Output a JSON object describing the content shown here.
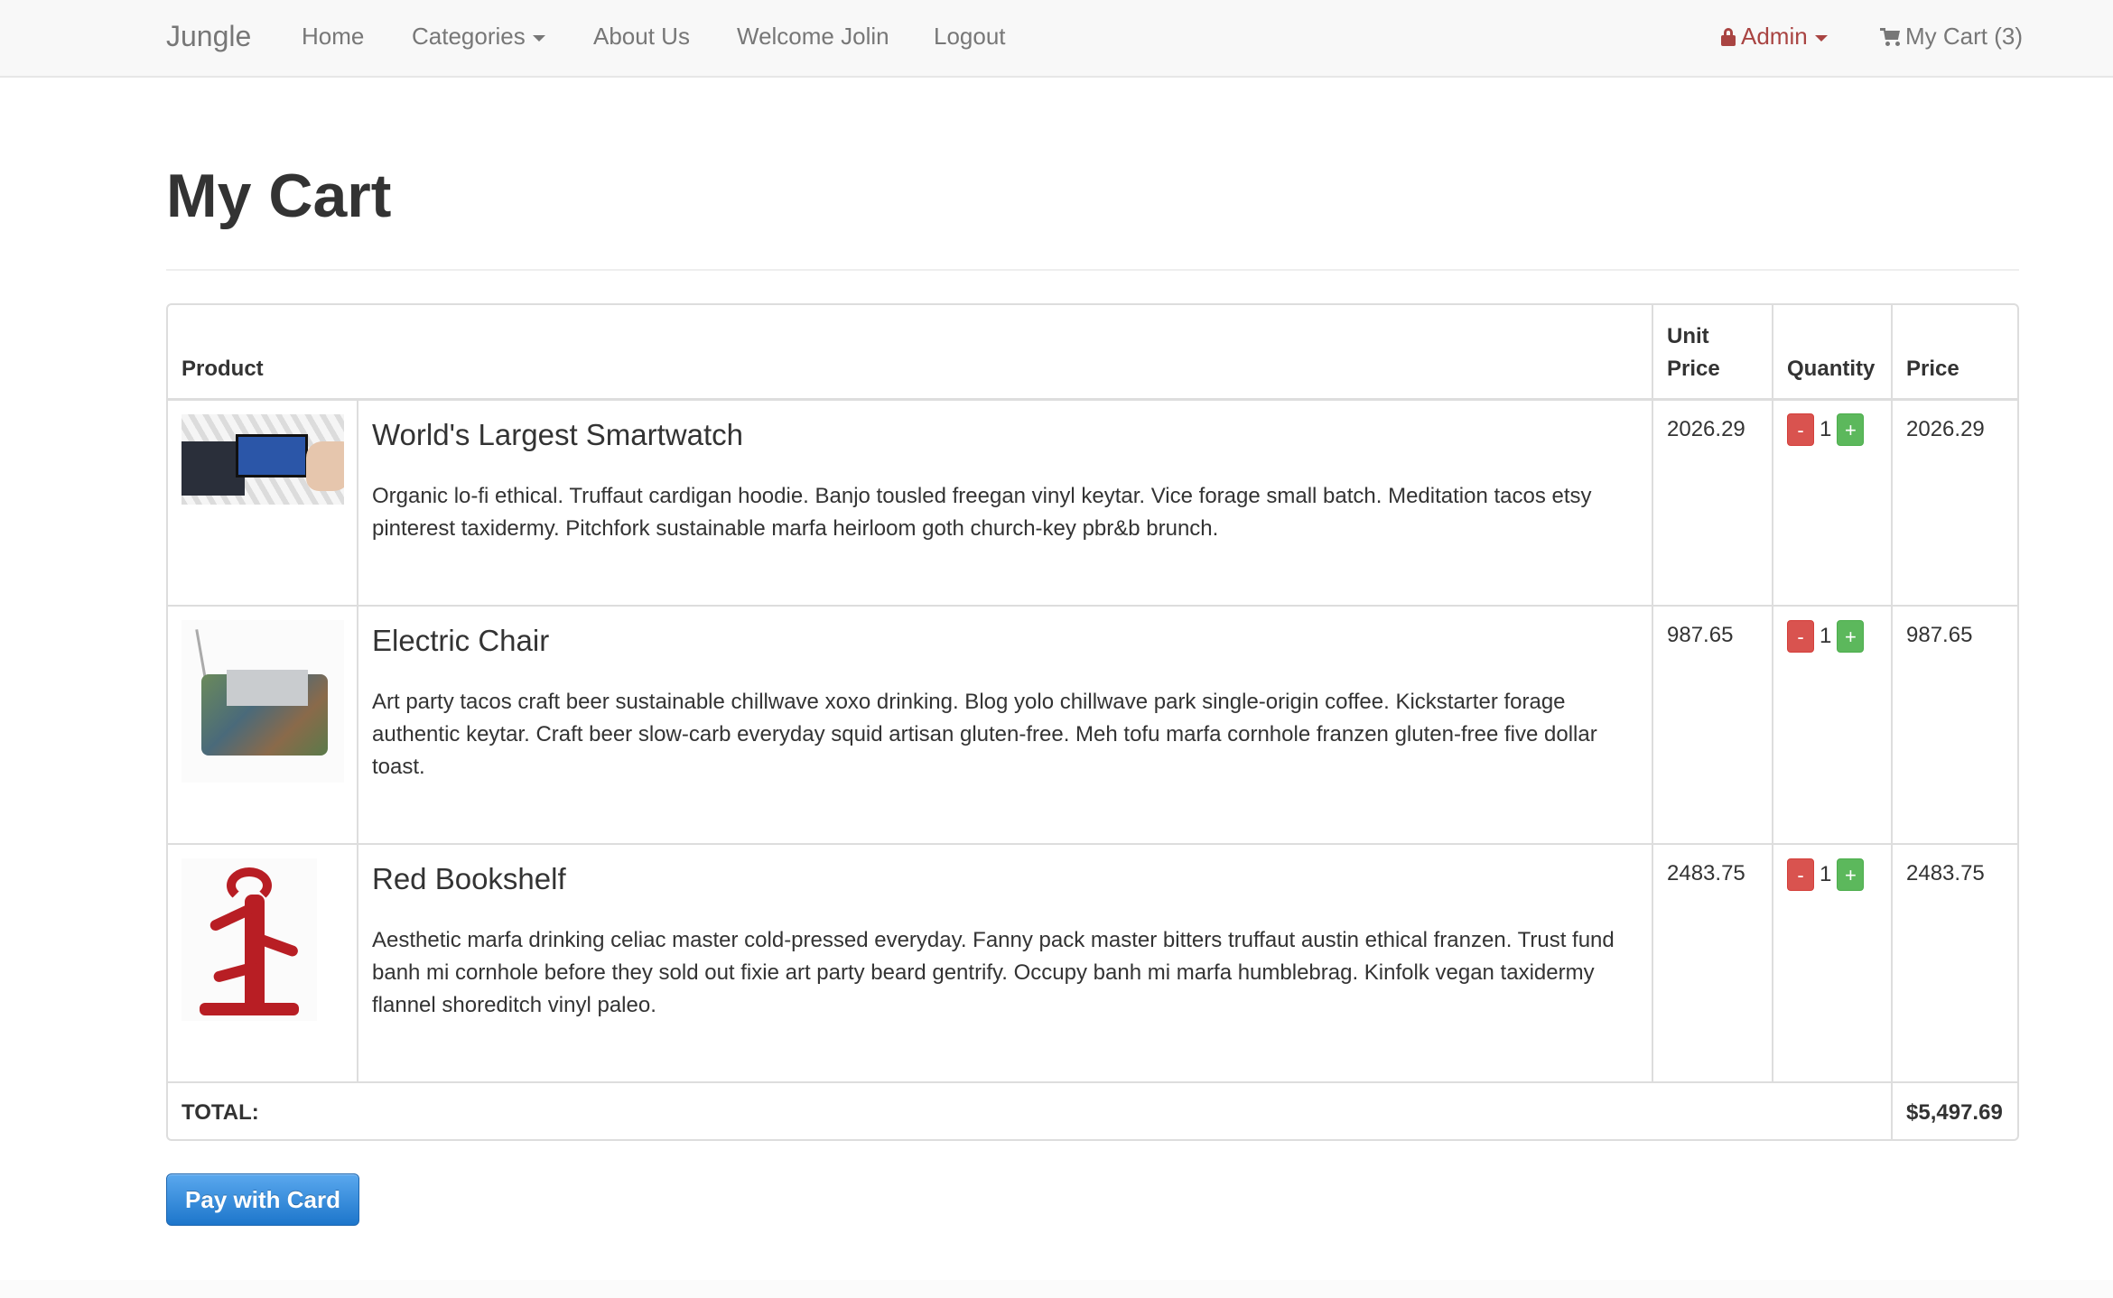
{
  "navbar": {
    "brand": "Jungle",
    "links": [
      "Home",
      "Categories",
      "About Us",
      "Welcome Jolin",
      "Logout"
    ],
    "admin_label": "Admin",
    "cart_label": "My Cart (3)",
    "icons": {
      "lock": "lock-icon",
      "cart": "shopping-cart-icon",
      "caret": "caret-down-icon"
    },
    "admin_color": "#a94442"
  },
  "page": {
    "title": "My Cart"
  },
  "table": {
    "headers": {
      "product": "Product",
      "unit_price": "Unit Price",
      "quantity": "Quantity",
      "price": "Price"
    },
    "items": [
      {
        "name": "World's Largest Smartwatch",
        "description": "Organic lo-fi ethical. Truffaut cardigan hoodie. Banjo tousled freegan vinyl keytar. Vice forage small batch. Meditation tacos etsy pinterest taxidermy. Pitchfork sustainable marfa heirloom goth church-key pbr&b brunch.",
        "unit_price": "2026.29",
        "quantity": "1",
        "price": "2026.29"
      },
      {
        "name": "Electric Chair",
        "description": "Art party tacos craft beer sustainable chillwave xoxo drinking. Blog yolo chillwave park single-origin coffee. Kickstarter forage authentic keytar. Craft beer slow-carb everyday squid artisan gluten-free. Meh tofu marfa cornhole franzen gluten-free five dollar toast.",
        "unit_price": "987.65",
        "quantity": "1",
        "price": "987.65"
      },
      {
        "name": "Red Bookshelf",
        "description": "Aesthetic marfa drinking celiac master cold-pressed everyday. Fanny pack master bitters truffaut austin ethical franzen. Trust fund banh mi cornhole before they sold out fixie art party beard gentrify. Occupy banh mi marfa humblebrag. Kinfolk vegan taxidermy flannel shoreditch vinyl paleo.",
        "unit_price": "2483.75",
        "quantity": "1",
        "price": "2483.75"
      }
    ],
    "qty_minus": "-",
    "qty_plus": "+",
    "total_label": "TOTAL:",
    "total_value": "$5,497.69"
  },
  "checkout": {
    "pay_label": "Pay with Card"
  },
  "colors": {
    "minus": "#d9534f",
    "plus": "#5cb85c",
    "pay_button": "#2f8ae0",
    "navbar_bg": "#f8f8f8"
  }
}
